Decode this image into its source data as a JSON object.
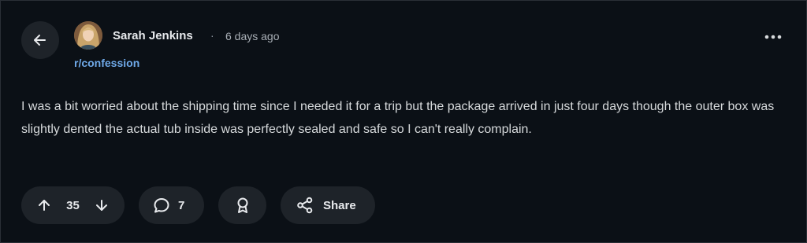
{
  "post": {
    "author": "Sarah Jenkins",
    "separator": "·",
    "time": "6 days ago",
    "subreddit": "r/confession",
    "body": "I was a bit worried about the shipping time since I needed it for a trip but the package arrived in just four days though the outer box was slightly dented the actual tub inside was perfectly sealed and safe so I can't really complain."
  },
  "actions": {
    "vote_count": "35",
    "comment_count": "7",
    "share_label": "Share"
  },
  "icons": {
    "back": "arrow-left-icon",
    "more": "more-horizontal-icon",
    "upvote": "arrow-up-icon",
    "downvote": "arrow-down-icon",
    "comment": "comment-bubble-icon",
    "award": "award-ribbon-icon",
    "share": "share-nodes-icon"
  },
  "colors": {
    "background": "#0b1016",
    "button_bg": "#1e2329",
    "text": "#d7dadc",
    "subreddit_link": "#6fa9e8",
    "muted": "#a8aeb5"
  }
}
